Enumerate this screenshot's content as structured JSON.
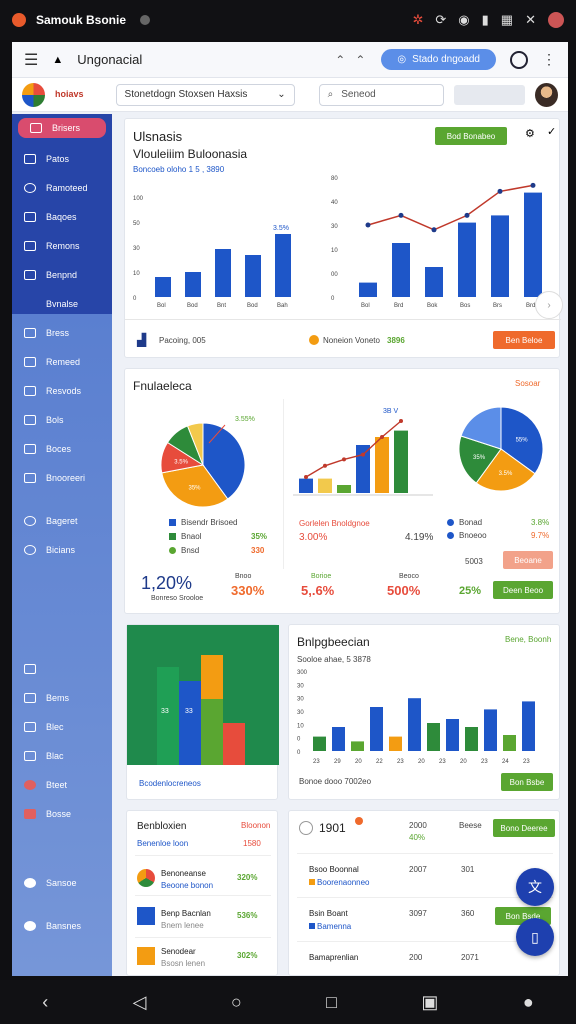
{
  "status": {
    "app_title": "Samouk Bsonie",
    "icons": [
      "bug-icon",
      "sync-icon",
      "record-icon",
      "battery-icon",
      "grid-icon",
      "close-icon",
      "profile-icon"
    ]
  },
  "topbar": {
    "title": "Ungonacial",
    "action_label": "Stado dngoadd"
  },
  "secondbar": {
    "logo_text": "hoiavs",
    "select_value": "Stonetdogn Stoxsen Haxsis",
    "search_placeholder": "Seneod",
    "ghost_button": ""
  },
  "sidebar": {
    "items": [
      "Brisers",
      "Patos",
      "Ramoteed",
      "Baqoes",
      "Remons",
      "Benpnd",
      "Bvnalse",
      "Bress",
      "Remeed",
      "Resvods",
      "Bols",
      "Boces",
      "Bnooreeri",
      "Bageret",
      "Bicians",
      "",
      "Bems",
      "Blec",
      "Blac",
      "Bteet",
      "Bosse",
      "Sansoe",
      "Bansnes"
    ]
  },
  "card1": {
    "title": "Ulsnasis",
    "subtitle": "Vlouleiiim Buloonasia",
    "left_caption": "Boncoeb oloho 1 5 , 3890",
    "bar_label": "3.5%",
    "action_button": "Bod Bonabeo",
    "footer_left": "Pacoing, 005",
    "footer_mid": "Noneion Voneto",
    "footer_mid_val": "3896",
    "footer_button": "Ben Beloe"
  },
  "chart_data": [
    {
      "type": "bar",
      "categories": [
        "Bol",
        "Bod",
        "Bnt",
        "Bod",
        "Bah"
      ],
      "values": [
        20,
        25,
        48,
        42,
        63
      ],
      "ylim": [
        0,
        100
      ],
      "yticks": [
        "0",
        "10",
        "30",
        "50",
        "100"
      ],
      "annotation": "3.5%"
    },
    {
      "type": "bar",
      "categories": [
        "Bol",
        "Brd",
        "Bok",
        "Bos",
        "Brs",
        "Brd"
      ],
      "values": [
        12,
        45,
        25,
        62,
        68,
        87
      ],
      "line": [
        60,
        68,
        56,
        68,
        88,
        93
      ],
      "yticks": [
        "0",
        "00",
        "10",
        "30",
        "40",
        "80"
      ]
    },
    {
      "type": "pie",
      "values": [
        40,
        32,
        12,
        10,
        6
      ],
      "labels": [
        "",
        "35%",
        "3.5%",
        "",
        ""
      ],
      "annotation": "3.55%"
    },
    {
      "type": "bar",
      "values": [
        18,
        18,
        10,
        60,
        70,
        78
      ],
      "line": [
        20,
        34,
        42,
        48,
        70,
        90
      ],
      "annotation": "3B V"
    },
    {
      "type": "pie",
      "values": [
        35,
        25,
        20,
        20
      ],
      "labels": [
        "55%",
        "3.5%",
        "35%",
        ""
      ]
    },
    {
      "type": "bar",
      "values": [
        70,
        60,
        50,
        30
      ],
      "labels": [
        "33",
        "33"
      ]
    },
    {
      "type": "bar",
      "categories": [
        "23",
        "29",
        "20",
        "22",
        "23",
        "20",
        "23",
        "20",
        "23",
        "24",
        "23"
      ],
      "values": [
        18,
        30,
        12,
        55,
        18,
        66,
        35,
        40,
        30,
        52,
        20,
        62
      ],
      "yticks": [
        "0",
        "0",
        "10",
        "30",
        "30",
        "30",
        "300"
      ]
    }
  ],
  "card2": {
    "title": "Fnulaeleca",
    "tag": "Sosoar",
    "pie1_legend": [
      "Bisendr Brisoed",
      "Bnaol",
      "Bnsd"
    ],
    "pie1_vals": [
      "35%",
      "330"
    ],
    "bar_legend_title": "Gorlelen Bnoldgnoe",
    "bar_vals": [
      "3.00%",
      "4.19%"
    ],
    "pie2_legend": [
      "Bonad",
      "Bnoeoo"
    ],
    "pie2_vals": [
      "3.8%",
      "9.7%"
    ],
    "stat1_value": "1,20%",
    "stat1_label": "Bonreso Srooloe",
    "stat2_value": "330%",
    "stat2_label": "Bnoo",
    "stat3_value": "5,.6%",
    "stat3_label": "Borioe",
    "stat4_value": "500%",
    "stat4_label": "Beoco",
    "stat5_value": "25%",
    "stat5_top": "5003",
    "btn1": "Beoane",
    "btn2": "Deen Beoo"
  },
  "card3": {
    "footer": "Bcodenlocreneos"
  },
  "card4": {
    "title": "Bnlpgbeecian",
    "subtitle": "Sooloe ahae, 5 3878",
    "corner": "Bene, Boonh",
    "footer": "Bonoe dooo 7002eo",
    "button": "Bon Bsbe"
  },
  "card5": {
    "title": "Benbloxien",
    "tag": "Bloonon",
    "sub": "Benenloe loon",
    "sub_val": "1580",
    "rows": [
      {
        "name": "Benoneanse",
        "sub": "Beoone bonon",
        "val": "320%"
      },
      {
        "name": "Benp Bacnlan",
        "sub": "Bnem lenee",
        "val": "536%"
      },
      {
        "name": "Senodear",
        "sub": "Bsosn lenen",
        "val": "302%"
      }
    ]
  },
  "card6": {
    "title": "1901",
    "col1": "2000",
    "col1_val": "40%",
    "col2": "Beese",
    "button": "Bono Deeree",
    "rows": [
      {
        "name": "Bsoo Boonnal",
        "sub": "Boorenaonneo",
        "a": "2007",
        "b": "301"
      },
      {
        "name": "Bsin Boant",
        "sub": "Bamenna",
        "a": "3097",
        "b": "360"
      },
      {
        "name": "Bamaprenlian",
        "sub": "",
        "a": "200",
        "b": "2071"
      }
    ],
    "row_button": "Bon Bsde"
  }
}
